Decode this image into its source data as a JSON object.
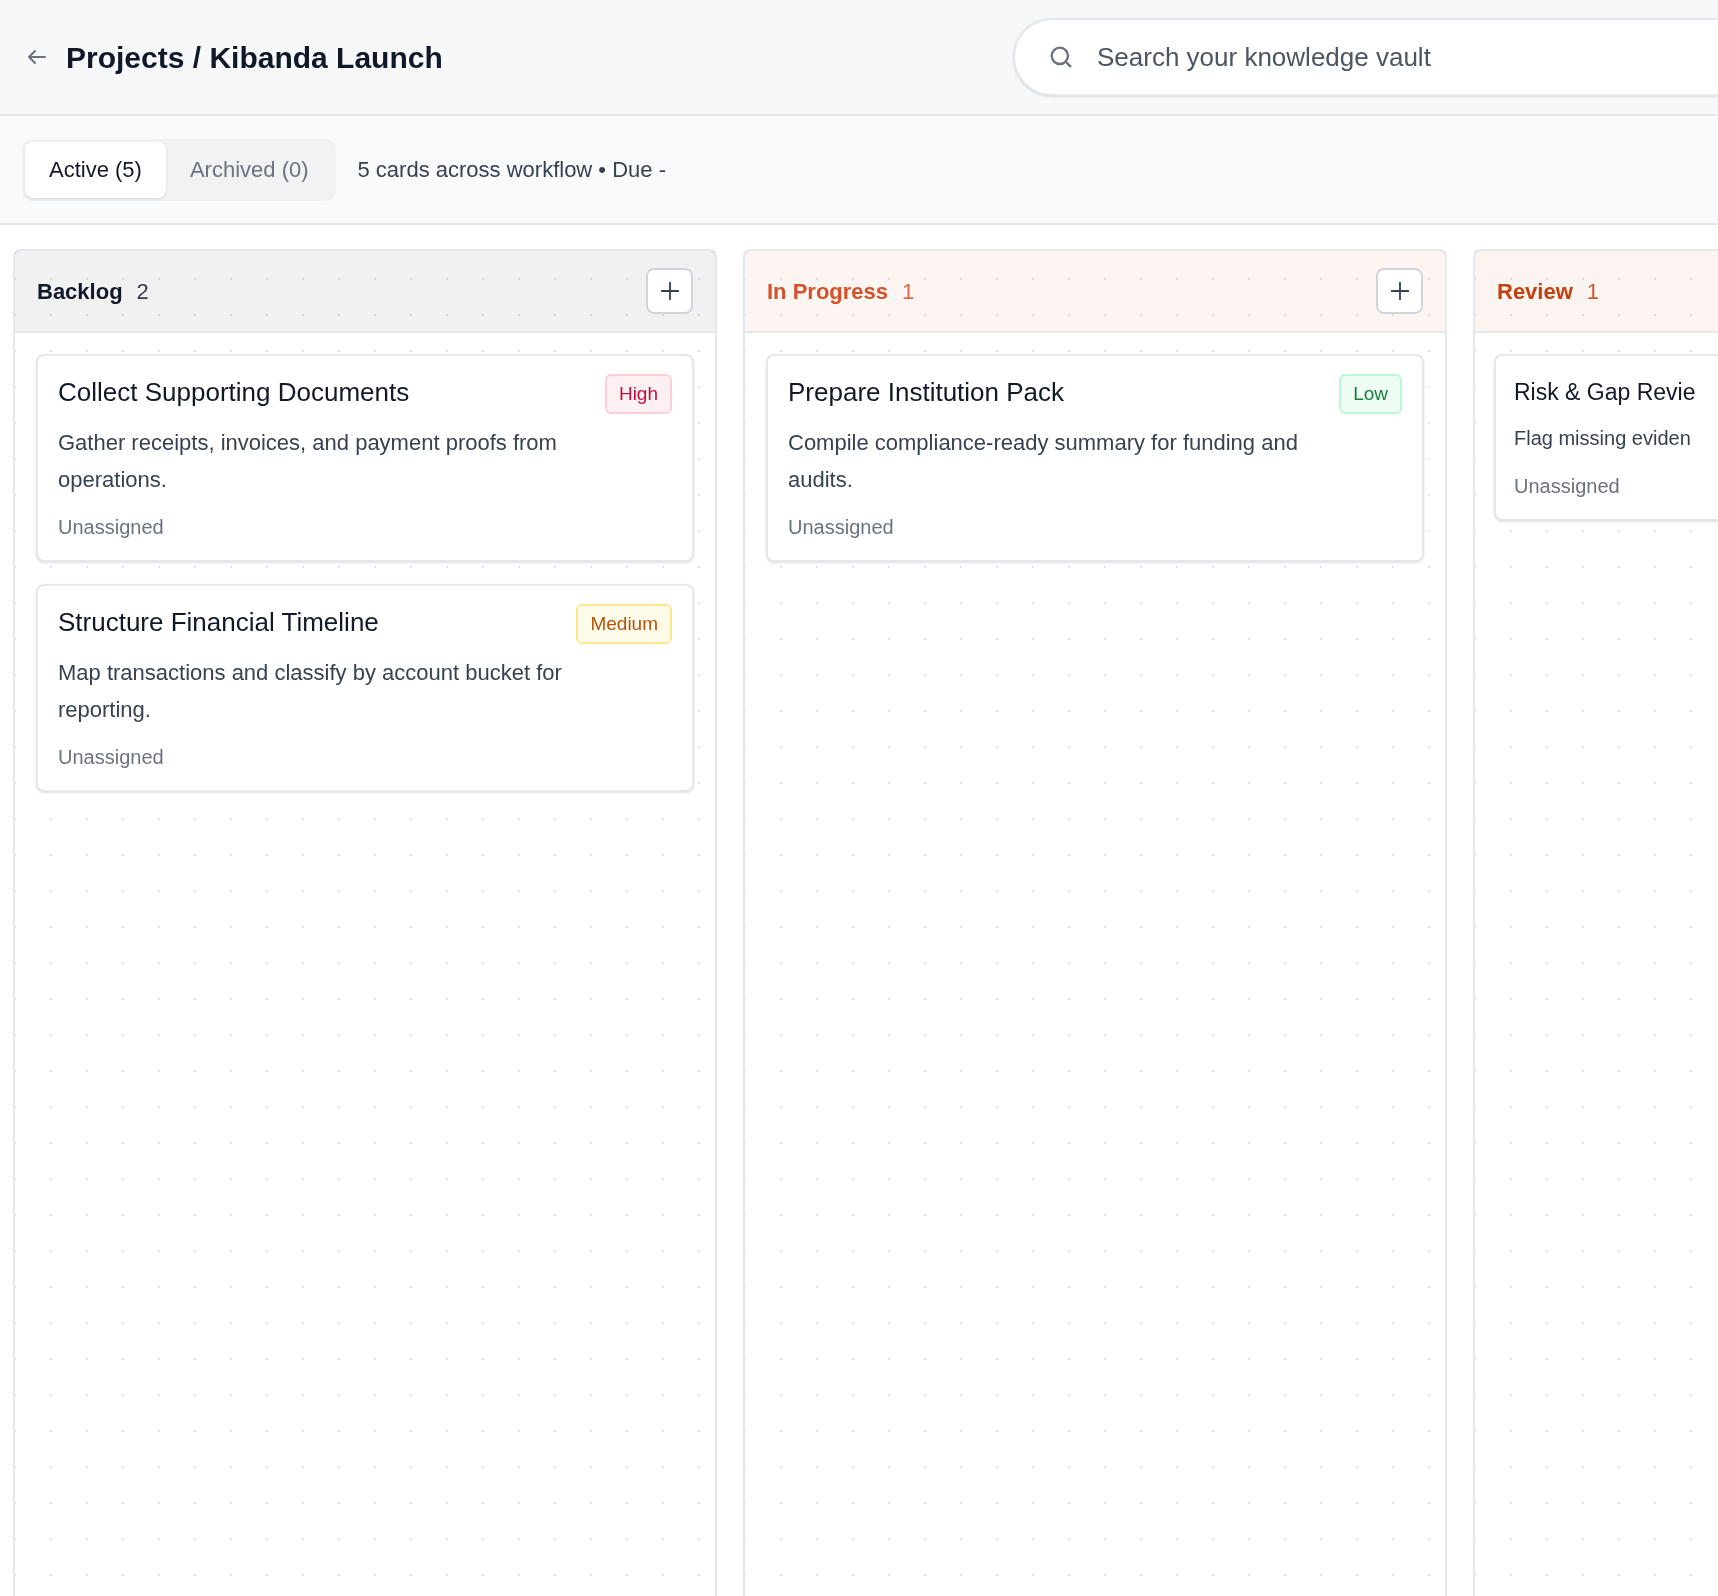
{
  "header": {
    "title": "Projects / Kibanda Launch",
    "search": {
      "placeholder": "Search your knowledge vault"
    }
  },
  "tabs": [
    {
      "label": "Active (5)",
      "selected": true
    },
    {
      "label": "Archived (0)",
      "selected": false
    }
  ],
  "summary": "5 cards across workflow • Due -",
  "columns": [
    {
      "title": "Backlog",
      "count": "2",
      "color": "#111827",
      "add_button": true,
      "cards": [
        {
          "title": "Collect Supporting Documents",
          "priority": {
            "label": "High",
            "kind": "high"
          },
          "description": "Gather receipts, invoices, and payment proofs from operations.",
          "assignee": "Unassigned"
        },
        {
          "title": "Structure Financial Timeline",
          "priority": {
            "label": "Medium",
            "kind": "medium"
          },
          "description": "Map transactions and classify by account bucket for reporting.",
          "assignee": "Unassigned"
        }
      ]
    },
    {
      "title": "In Progress",
      "count": "1",
      "color": "#d4512a",
      "add_button": true,
      "cards": [
        {
          "title": "Prepare Institution Pack",
          "priority": {
            "label": "Low",
            "kind": "low"
          },
          "description": "Compile compliance-ready summary for funding and audits.",
          "assignee": "Unassigned"
        }
      ]
    },
    {
      "title": "Review",
      "count": "1",
      "color": "#c2410c",
      "add_button": false,
      "cards": [
        {
          "title": "Risk & Gap Revie",
          "description": "Flag missing eviden",
          "assignee": "Unassigned"
        }
      ]
    }
  ]
}
